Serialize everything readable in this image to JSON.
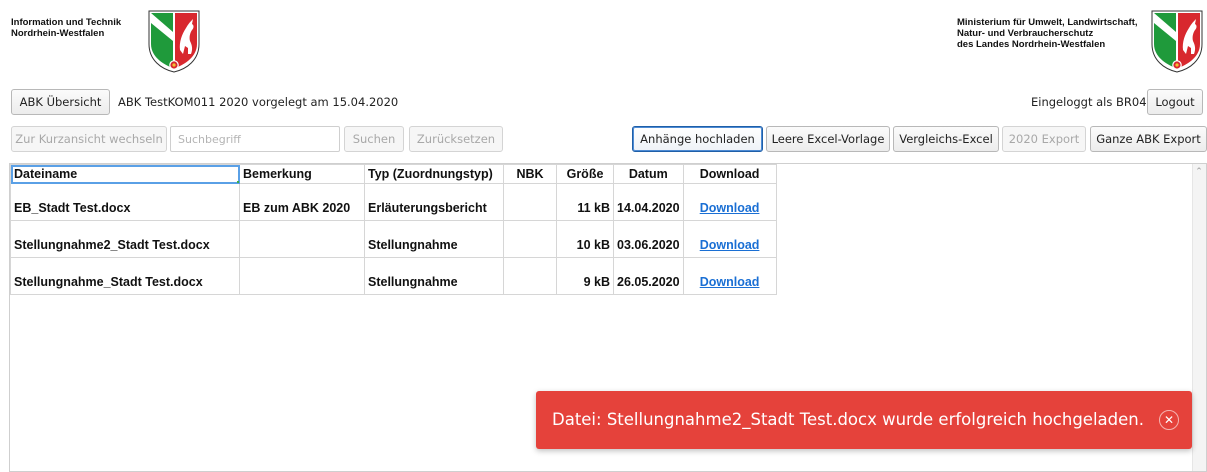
{
  "header": {
    "left_org_line1": "Information und Technik",
    "left_org_line2": "Nordrhein-Westfalen",
    "right_org_line1": "Ministerium für Umwelt, Landwirtschaft,",
    "right_org_line2": "Natur- und Verbraucherschutz",
    "right_org_line3": "des Landes Nordrhein-Westfalen",
    "crest_icon": "nrw-coat-of-arms-icon",
    "crest_colors": {
      "green": "#1f9a3b",
      "red": "#d8282e",
      "white": "#ffffff"
    }
  },
  "topbar": {
    "overview_button": "ABK Übersicht",
    "context_text": "ABK TestKOM011 2020 vorgelegt am 15.04.2020",
    "logged_in_text": "Eingeloggt als BR04",
    "logout_button": "Logout"
  },
  "toolbar": {
    "short_view_button": "Zur Kurzansicht wechseln",
    "search_placeholder": "Suchbegriff",
    "search_value": "",
    "search_button": "Suchen",
    "reset_button": "Zurücksetzen",
    "upload_button": "Anhänge hochladen",
    "empty_excel_button": "Leere Excel-Vorlage",
    "compare_excel_button": "Vergleichs-Excel",
    "export_2020_button": "2020 Export",
    "full_export_button": "Ganze ABK Export"
  },
  "table": {
    "columns": [
      "Dateiname",
      "Bemerkung",
      "Typ (Zuordnungstyp)",
      "NBK",
      "Größe",
      "Datum",
      "Download"
    ],
    "rows": [
      {
        "filename": "EB_Stadt Test.docx",
        "remark": "EB zum ABK 2020",
        "type": "Erläuterungsbericht",
        "nbk": "",
        "size": "11 kB",
        "date": "14.04.2020",
        "download": "Download"
      },
      {
        "filename": "Stellungnahme2_Stadt Test.docx",
        "remark": "",
        "type": "Stellungnahme",
        "nbk": "",
        "size": "10 kB",
        "date": "03.06.2020",
        "download": "Download"
      },
      {
        "filename": "Stellungnahme_Stadt Test.docx",
        "remark": "",
        "type": "Stellungnahme",
        "nbk": "",
        "size": "9 kB",
        "date": "26.05.2020",
        "download": "Download"
      }
    ]
  },
  "toast": {
    "message": "Datei: Stellungnahme2_Stadt Test.docx wurde erfolgreich hochgeladen.",
    "close_icon": "close-circle-icon",
    "color": "#e5423b"
  }
}
